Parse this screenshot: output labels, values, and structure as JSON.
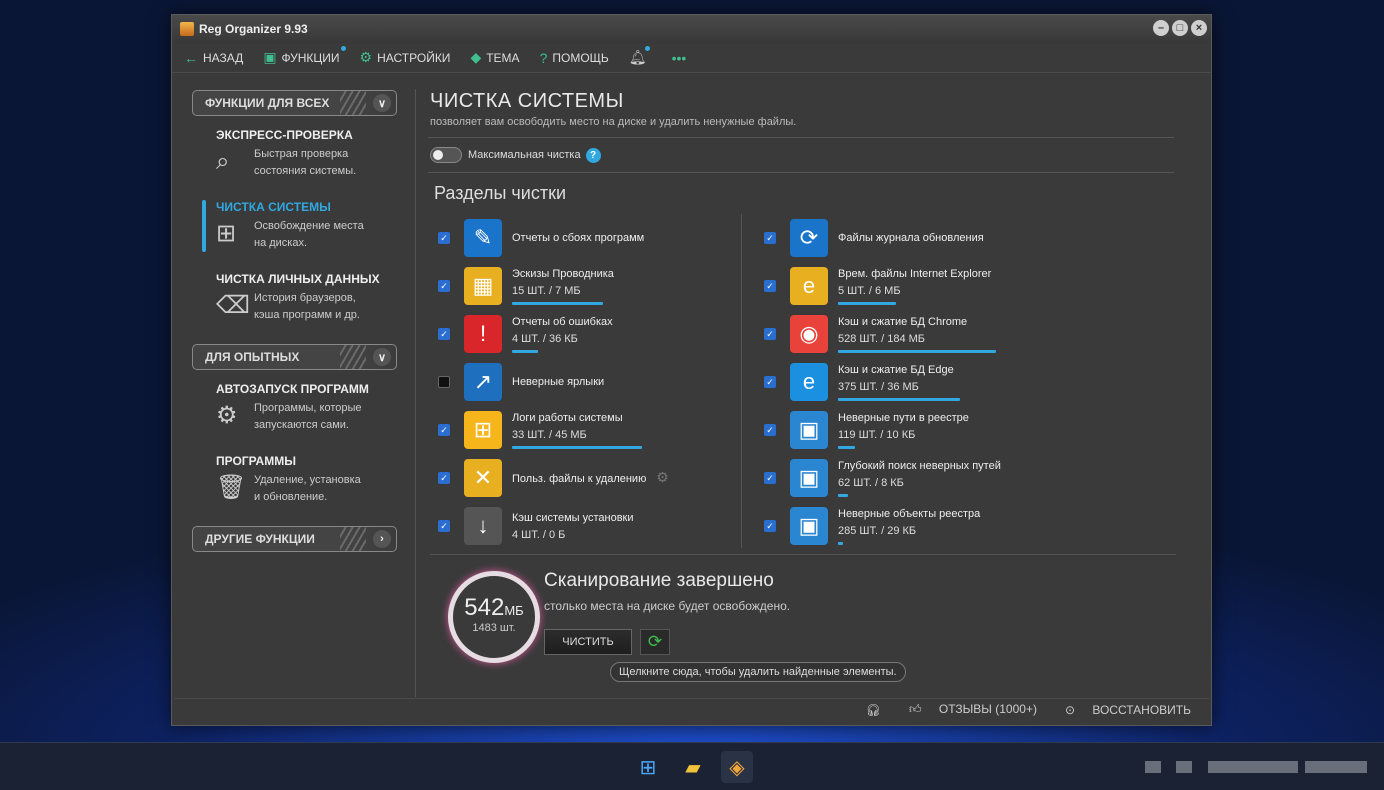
{
  "window": {
    "title": "Reg Organizer 9.93"
  },
  "menu": [
    {
      "icon": "back-arrow-icon",
      "glyph": "←",
      "label": "НАЗАД"
    },
    {
      "icon": "toolbox-icon",
      "glyph": "▣",
      "label": "ФУНКЦИИ"
    },
    {
      "icon": "gear-icon",
      "glyph": "⚙",
      "label": "НАСТРОЙКИ"
    },
    {
      "icon": "theme-icon",
      "glyph": "◆",
      "label": "ТЕМА"
    },
    {
      "icon": "help-icon",
      "glyph": "?",
      "label": "ПОМОЩЬ"
    }
  ],
  "sidebar": {
    "group1": "ФУНКЦИИ ДЛЯ ВСЕХ",
    "group2": "ДЛЯ ОПЫТНЫХ",
    "group3": "ДРУГИЕ ФУНКЦИИ",
    "items": [
      {
        "title": "ЭКСПРЕСС-ПРОВЕРКА",
        "d1": "Быстрая проверка",
        "d2": "состояния системы."
      },
      {
        "title": "ЧИСТКА СИСТЕМЫ",
        "d1": "Освобождение места",
        "d2": "на дисках."
      },
      {
        "title": "ЧИСТКА ЛИЧНЫХ ДАННЫХ",
        "d1": "История браузеров,",
        "d2": "кэша программ и др."
      },
      {
        "title": "АВТОЗАПУСК ПРОГРАММ",
        "d1": "Программы, которые",
        "d2": "запускаются сами."
      },
      {
        "title": "ПРОГРАММЫ",
        "d1": "Удаление, установка",
        "d2": "и обновление."
      }
    ]
  },
  "main": {
    "title": "ЧИСТКА СИСТЕМЫ",
    "subtitle": "позволяет вам освободить место на диске и удалить ненужные файлы.",
    "max_clean": "Максимальная чистка",
    "sections_title": "Разделы чистки",
    "left": [
      {
        "label": "Отчеты о сбоях программ",
        "count": "",
        "checked": true,
        "bar": 0
      },
      {
        "label": "Эскизы Проводника",
        "count": "15 ШТ. / 7 МБ",
        "checked": true,
        "bar": 0.38
      },
      {
        "label": "Отчеты об ошибках",
        "count": "4 ШТ. / 36 КБ",
        "checked": true,
        "bar": 0.11
      },
      {
        "label": "Неверные ярлыки",
        "count": "",
        "checked": false,
        "bar": 0
      },
      {
        "label": "Логи работы системы",
        "count": "33 ШТ. / 45 МБ",
        "checked": true,
        "bar": 0.54
      },
      {
        "label": "Польз. файлы к удалению",
        "count": "",
        "checked": true,
        "bar": 0
      },
      {
        "label": "Кэш системы установки",
        "count": "4 ШТ. / 0 Б",
        "checked": true,
        "bar": 0
      }
    ],
    "right": [
      {
        "label": "Файлы журнала обновления",
        "count": "",
        "checked": true,
        "bar": 0
      },
      {
        "label": "Врем. файлы Internet Explorer",
        "count": "5 ШТ. / 6 МБ",
        "checked": true,
        "bar": 0.24
      },
      {
        "label": "Кэш и сжатие БД Chrome",
        "count": "528 ШТ. / 184 МБ",
        "checked": true,
        "bar": 0.66
      },
      {
        "label": "Кэш и сжатие БД Edge",
        "count": "375 ШТ. / 36 МБ",
        "checked": true,
        "bar": 0.51
      },
      {
        "label": "Неверные пути в реестре",
        "count": "119 ШТ. / 10 КБ",
        "checked": true,
        "bar": 0.07
      },
      {
        "label": "Глубокий поиск неверных путей",
        "count": "62 ШТ. / 8 КБ",
        "checked": true,
        "bar": 0.04
      },
      {
        "label": "Неверные объекты реестра",
        "count": "285 ШТ. / 29 КБ",
        "checked": true,
        "bar": 0.02
      }
    ],
    "result": {
      "size": "542",
      "unit": "МБ",
      "items": "1483 шт.",
      "title": "Сканирование завершено",
      "subtitle": "столько места на диске будет освобождено.",
      "clean_button": "ЧИСТИТЬ",
      "tip": "Щелкните сюда, чтобы удалить найденные элементы."
    }
  },
  "status": {
    "reviews": "ОТЗЫВЫ (1000+)",
    "restore": "ВОССТАНОВИТЬ"
  },
  "colors": {
    "accent": "#31a8e0",
    "green": "#3fbf8f"
  }
}
